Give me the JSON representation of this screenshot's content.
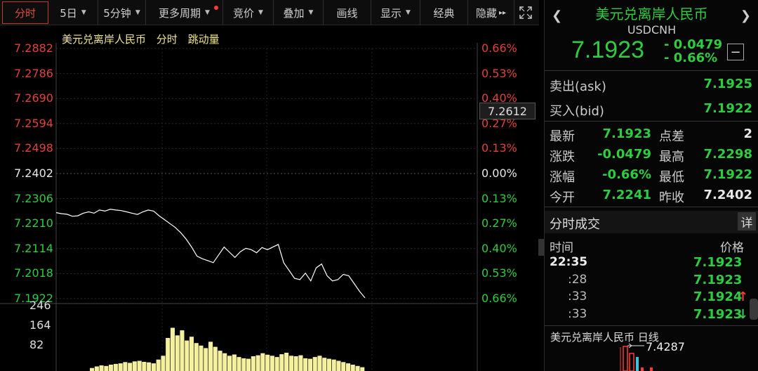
{
  "toolbar": {
    "tabs": [
      {
        "label": "分时",
        "caret": false
      },
      {
        "label": "5日",
        "caret": true
      },
      {
        "label": "5分钟",
        "caret": true
      },
      {
        "label": "更多周期",
        "caret": true
      },
      {
        "label": "竞价",
        "caret": true
      },
      {
        "label": "叠加",
        "caret": true
      },
      {
        "label": "画线",
        "caret": false
      },
      {
        "label": "显示",
        "caret": true
      },
      {
        "label": "经典",
        "caret": false
      },
      {
        "label": "隐藏",
        "caret": false
      }
    ],
    "hide_arrow": "▸▸",
    "fullscreen_icon": "expand-icon"
  },
  "chart": {
    "title_name": "美元兑离岸人民币",
    "title_mode": "分时",
    "title_indicator": "跳动量",
    "price_tag": "7.2612",
    "left_axis": [
      "7.2882",
      "7.2786",
      "7.2690",
      "7.2594",
      "7.2498",
      "7.2402",
      "7.2306",
      "7.2210",
      "7.2114",
      "7.2018",
      "7.1922"
    ],
    "right_axis": [
      "0.66%",
      "0.53%",
      "0.40%",
      "0.27%",
      "0.13%",
      "0.00%",
      "0.13%",
      "0.27%",
      "0.40%",
      "0.53%",
      "0.66%"
    ],
    "volume_axis": [
      "246",
      "164",
      "82"
    ],
    "colors": {
      "up": "#e0413a",
      "down": "#2ecc40",
      "flat": "#e8e8e8",
      "volume": "#f5f0a0",
      "line": "#ffffff"
    }
  },
  "chart_data": {
    "type": "line",
    "ylim": [
      7.1922,
      7.2882
    ],
    "series": [
      {
        "values": [
          7.2252,
          7.2248,
          7.2246,
          7.2238,
          7.224,
          7.225,
          7.2255,
          7.225,
          7.2262,
          7.2258,
          7.2265,
          7.2262,
          7.226,
          7.2255,
          7.225,
          7.2245,
          7.2255,
          7.2262,
          7.2258,
          7.224,
          7.2225,
          7.221,
          7.2195,
          7.2175,
          7.215,
          7.212,
          7.2085,
          7.2075,
          7.2068,
          7.206,
          7.209,
          7.212,
          7.21,
          7.208,
          7.2102,
          7.2115,
          7.211,
          7.2098,
          7.2118,
          7.211,
          7.212,
          7.213,
          7.206,
          7.203,
          7.2,
          7.1995,
          7.202,
          7.199,
          7.204,
          7.2055,
          7.201,
          7.199,
          7.1995,
          7.2015,
          7.201,
          7.198,
          7.195,
          7.1925
        ]
      }
    ],
    "volume_ylim": [
      0,
      246
    ],
    "volume": [
      12,
      18,
      22,
      20,
      25,
      28,
      30,
      35,
      32,
      38,
      40,
      36,
      34,
      30,
      45,
      60,
      130,
      170,
      140,
      160,
      120,
      135,
      110,
      100,
      90,
      115,
      95,
      80,
      70,
      60,
      65,
      55,
      50,
      48,
      58,
      62,
      70,
      64,
      60,
      55,
      66,
      72,
      60,
      58,
      62,
      50,
      48,
      55,
      60,
      52,
      48,
      45,
      40,
      35,
      30,
      25,
      20,
      15
    ]
  },
  "panel": {
    "name": "美元兑离岸人民币",
    "code": "USDCNH",
    "price": "7.1923",
    "change": "- 0.0479",
    "change_pct": "- 0.66%",
    "ask_label": "卖出(ask)",
    "ask": "7.1925",
    "bid_label": "买入(bid)",
    "bid": "7.1922",
    "stats": [
      {
        "l1": "最新",
        "v1": "7.1923",
        "c1": "g",
        "l2": "点差",
        "v2": "2",
        "c2": "w"
      },
      {
        "l1": "涨跌",
        "v1": "-0.0479",
        "c1": "g",
        "l2": "最高",
        "v2": "7.2298",
        "c2": "g"
      },
      {
        "l1": "涨幅",
        "v1": "-0.66%",
        "c1": "g",
        "l2": "最低",
        "v2": "7.1922",
        "c2": "g"
      },
      {
        "l1": "今开",
        "v1": "7.2241",
        "c1": "g",
        "l2": "昨收",
        "v2": "7.2402",
        "c2": "w"
      }
    ],
    "ticks_title": "分时成交",
    "detail_label": "详",
    "time_col": "时间",
    "price_col": "价格",
    "ticks": [
      {
        "time": "22:35",
        "price": "7.1923",
        "arrow": ""
      },
      {
        "time": ":28",
        "price": "7.1923",
        "arrow": ""
      },
      {
        "time": ":33",
        "price": "7.1924",
        "arrow": "↑"
      },
      {
        "time": ":33",
        "price": "7.1923",
        "arrow": "↓"
      }
    ],
    "mini_title": "美元兑离岸人民币 日线",
    "mini_price": "7.4287"
  }
}
